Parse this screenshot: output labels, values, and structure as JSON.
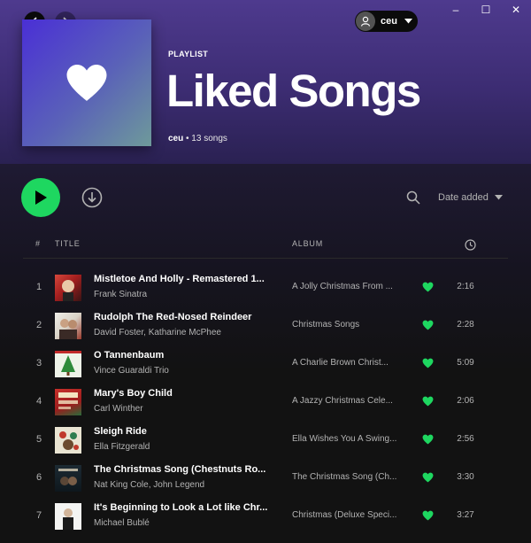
{
  "colors": {
    "accent": "#1ed760",
    "background": "#121212",
    "header": "#4e3a8e"
  },
  "window_controls": {
    "minimize": "–",
    "maximize": "☐",
    "close": "✕"
  },
  "user": {
    "name": "ceu"
  },
  "playlist": {
    "label": "PLAYLIST",
    "title": "Liked Songs",
    "owner": "ceu",
    "count_text": " • 13 songs"
  },
  "toolbar": {
    "sort_label": "Date added"
  },
  "columns": {
    "number": "#",
    "title": "TITLE",
    "album": "ALBUM",
    "duration_icon": "clock-icon"
  },
  "tracks": [
    {
      "num": "1",
      "title": "Mistletoe And Holly - Remastered 1...",
      "artist": "Frank Sinatra",
      "album": "A Jolly Christmas From ...",
      "duration": "2:16",
      "liked": true
    },
    {
      "num": "2",
      "title": "Rudolph The Red-Nosed Reindeer",
      "artist": "David Foster, Katharine McPhee",
      "album": "Christmas Songs",
      "duration": "2:28",
      "liked": true
    },
    {
      "num": "3",
      "title": "O Tannenbaum",
      "artist": "Vince Guaraldi Trio",
      "album": "A Charlie Brown Christ...",
      "duration": "5:09",
      "liked": true
    },
    {
      "num": "4",
      "title": "Mary's Boy Child",
      "artist": "Carl Winther",
      "album": "A Jazzy Christmas Cele...",
      "duration": "2:06",
      "liked": true
    },
    {
      "num": "5",
      "title": "Sleigh Ride",
      "artist": "Ella Fitzgerald",
      "album": "Ella Wishes You A Swing...",
      "duration": "2:56",
      "liked": true
    },
    {
      "num": "6",
      "title": "The Christmas Song (Chestnuts Ro...",
      "artist": "Nat King Cole, John Legend",
      "album": "The Christmas Song (Ch...",
      "duration": "3:30",
      "liked": true
    },
    {
      "num": "7",
      "title": "It's Beginning to Look a Lot like Chr...",
      "artist": "Michael Bublé",
      "album": "Christmas (Deluxe Speci...",
      "duration": "3:27",
      "liked": true
    }
  ]
}
